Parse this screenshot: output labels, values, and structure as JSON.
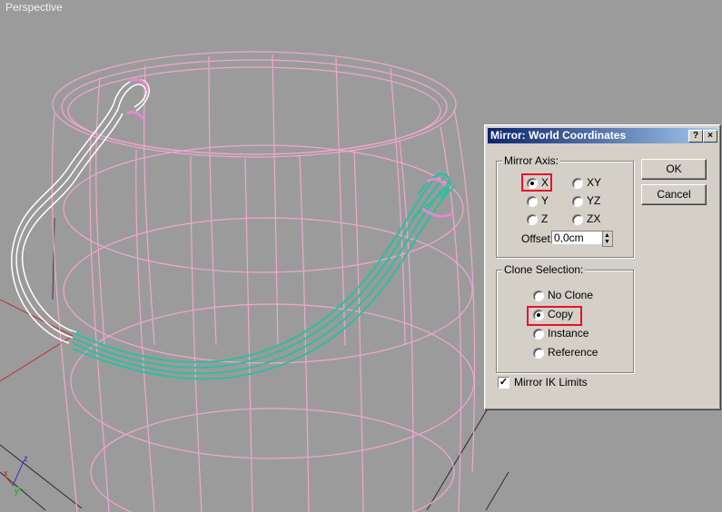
{
  "viewport": {
    "label": "Perspective",
    "axis_labels": {
      "x": "x",
      "y": "y",
      "z": "z"
    }
  },
  "dialog": {
    "title": "Mirror: World Coordinates",
    "help_glyph": "?",
    "close_glyph": "×",
    "mirror_axis": {
      "title": "Mirror Axis:",
      "options": [
        "X",
        "Y",
        "Z",
        "XY",
        "YZ",
        "ZX"
      ],
      "selected": "X",
      "offset_label": "Offset:",
      "offset_value": "0,0cm"
    },
    "clone_selection": {
      "title": "Clone Selection:",
      "options": [
        "No Clone",
        "Copy",
        "Instance",
        "Reference"
      ],
      "selected": "Copy"
    },
    "mirror_ik": {
      "label": "Mirror IK Limits",
      "checked": true
    },
    "ok_label": "OK",
    "cancel_label": "Cancel"
  },
  "colors": {
    "viewport_bg": "#9b9b9b",
    "wire_pink": "#f2a6cf",
    "handle_teal": "#2dbf9e",
    "handle_white": "#ffffff",
    "highlight_red": "#e8102a"
  }
}
